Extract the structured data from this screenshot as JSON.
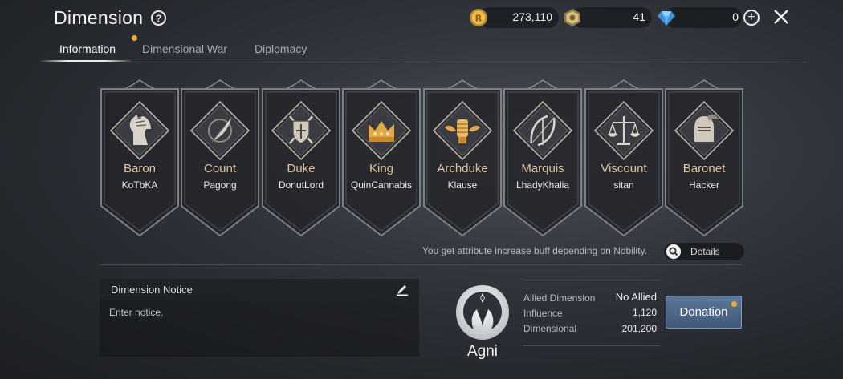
{
  "header": {
    "title": "Dimension",
    "help_icon": "question-circle-icon",
    "close_icon": "close-icon"
  },
  "currencies": [
    {
      "icon": "gold-coin-icon",
      "value": "273,110",
      "color": "#e3b13d"
    },
    {
      "icon": "honor-token-icon",
      "value": "41",
      "color": "#c9b06e"
    },
    {
      "icon": "diamond-icon",
      "value": "0",
      "color": "#5fb4f0"
    }
  ],
  "tabs": [
    {
      "label": "Information",
      "active": true
    },
    {
      "label": "Dimensional War",
      "active": false,
      "notification": true
    },
    {
      "label": "Diplomacy",
      "active": false
    }
  ],
  "nobility": [
    {
      "rank": "Baron",
      "player": "KoTbKA",
      "icon": "horse-head-icon"
    },
    {
      "rank": "Count",
      "player": "Pagong",
      "icon": "quill-icon"
    },
    {
      "rank": "Duke",
      "player": "DonutLord",
      "icon": "shield-swords-icon"
    },
    {
      "rank": "King",
      "player": "QuinCannabis",
      "icon": "crown-icon"
    },
    {
      "rank": "Archduke",
      "player": "Klause",
      "icon": "fist-wings-icon"
    },
    {
      "rank": "Marquis",
      "player": "LhadyKhalia",
      "icon": "bow-icon"
    },
    {
      "rank": "Viscount",
      "player": "sitan",
      "icon": "scales-icon"
    },
    {
      "rank": "Baronet",
      "player": "Hacker",
      "icon": "knight-helmet-icon"
    }
  ],
  "nobility_info": {
    "text": "You get attribute increase buff depending on Nobility.",
    "details_label": "Details"
  },
  "notice": {
    "title": "Dimension Notice",
    "placeholder": "Enter notice."
  },
  "dimension": {
    "name": "Agni",
    "crest_icon": "phoenix-crest-icon",
    "stats": [
      {
        "label": "Allied Dimension",
        "value": "No Allied"
      },
      {
        "label": "Influence",
        "value": "1,120"
      },
      {
        "label": "Dimensional",
        "value": "201,200"
      }
    ],
    "donation_label": "Donation"
  },
  "colors": {
    "rank_text": "#e4c49a",
    "notification_dot": "#f0a935",
    "donation_button": "#4d6789"
  }
}
